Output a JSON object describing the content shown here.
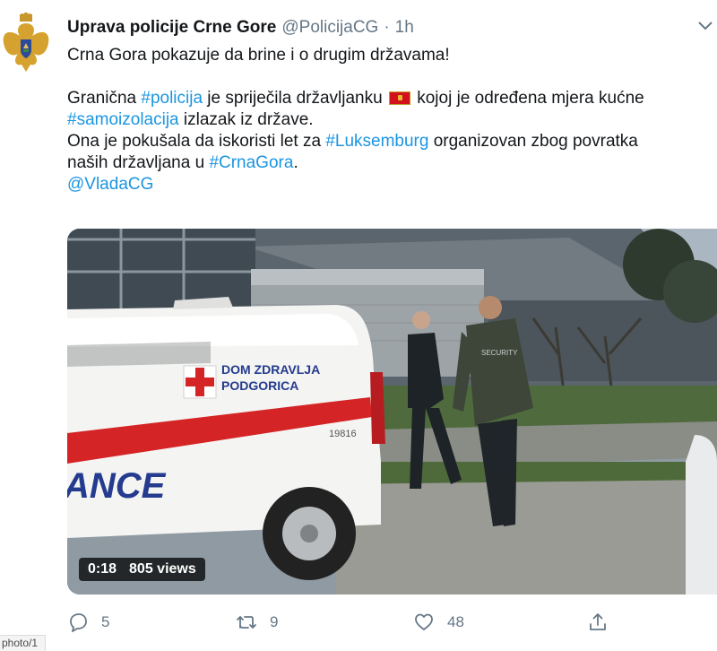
{
  "tweet": {
    "display_name": "Uprava policije Crne Gore",
    "handle": "@PolicijaCG",
    "separator": "·",
    "time": "1h",
    "line1": "Crna Gora pokazuje da brine i o drugim državama!",
    "line2_a": "Granična ",
    "line2_tag": "#policija",
    "line2_b": " je spriječila državljanku ",
    "line2_c": " kojoj je određena mjera kućne",
    "line3_tag": "#samoizolacija",
    "line3_b": " izlazak iz države.",
    "line4_a": "Ona je pokušala da iskoristi let za ",
    "line4_tag": "#Luksemburg",
    "line4_b": " organizovan zbog povratka",
    "line5_a": "naših državljana u ",
    "line5_tag": "#CrnaGora",
    "line5_b": ".",
    "mention": "@VladaCG",
    "flag_icon": "montenegro-flag-icon"
  },
  "media": {
    "duration": "0:18",
    "views": "805 views",
    "vehicle_text_line1": "DOM ZDRAVLJA",
    "vehicle_text_line2": "PODGORICA",
    "vehicle_number": "19816",
    "vehicle_side_text": "ANCE",
    "vest_text": "SECURITY"
  },
  "actions": {
    "reply_count": "5",
    "retweet_count": "9",
    "like_count": "48",
    "reply_icon": "reply-icon",
    "retweet_icon": "retweet-icon",
    "like_icon": "heart-icon",
    "share_icon": "share-icon"
  },
  "footer": {
    "tag": "photo/1"
  },
  "colors": {
    "link": "#1b95e0",
    "secondary_text": "#657786",
    "primary_text": "#14171a"
  }
}
